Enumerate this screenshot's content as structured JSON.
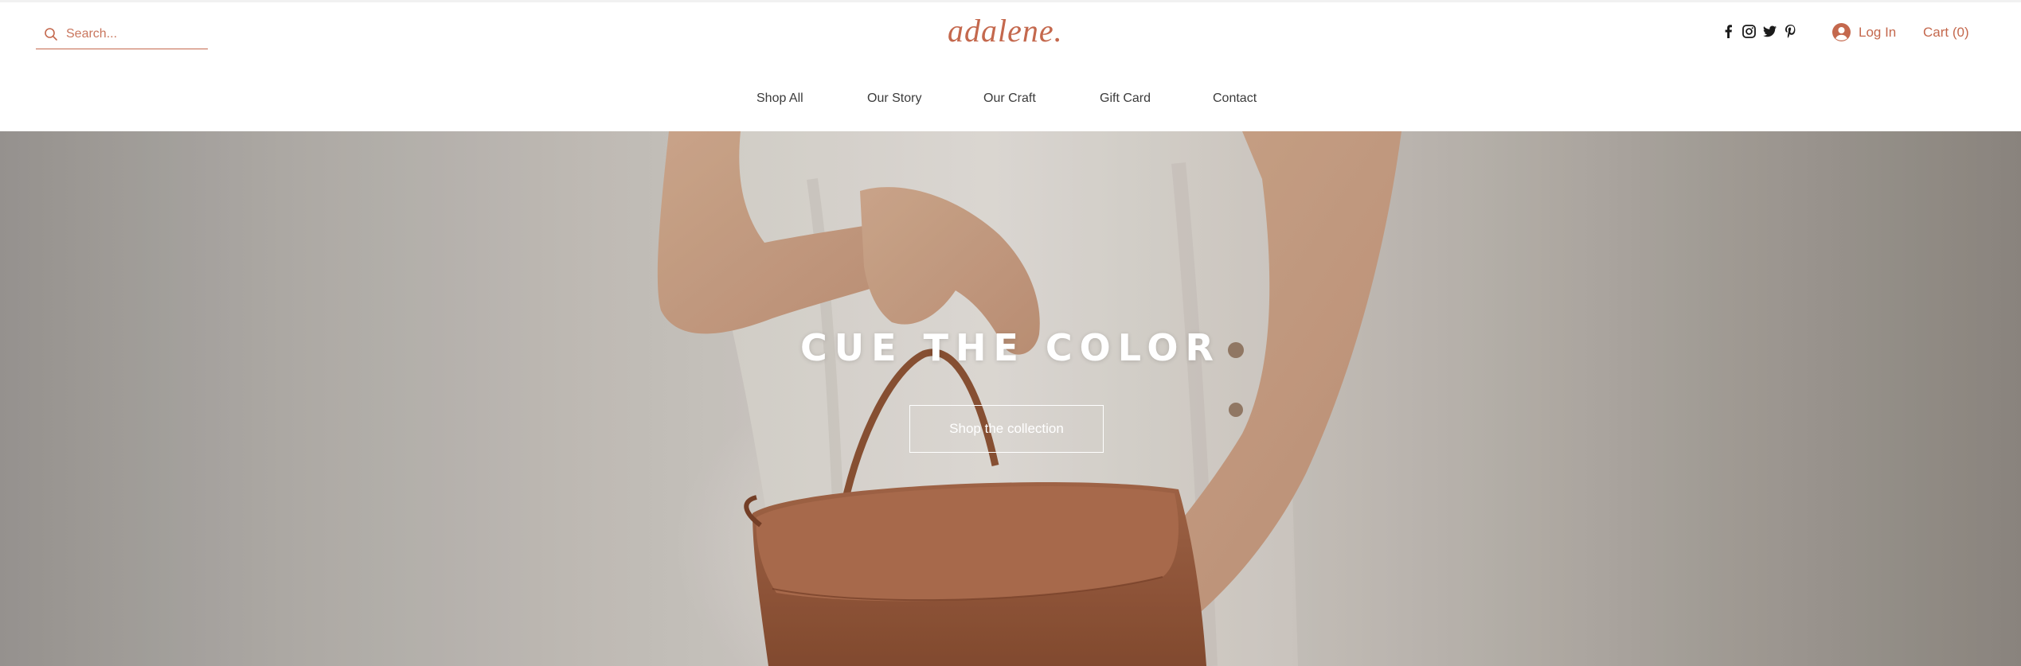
{
  "header": {
    "search": {
      "placeholder": "Search...",
      "icon": "search-icon"
    },
    "logo": "adalene.",
    "social": [
      {
        "name": "facebook-icon",
        "glyph": "f"
      },
      {
        "name": "instagram-icon",
        "glyph": "◎"
      },
      {
        "name": "twitter-icon",
        "glyph": "🐦"
      },
      {
        "name": "pinterest-icon",
        "glyph": "P"
      }
    ],
    "login_label": "Log In",
    "cart_label": "Cart (0)"
  },
  "nav": {
    "items": [
      "Shop All",
      "Our Story",
      "Our Craft",
      "Gift Card",
      "Contact"
    ]
  },
  "hero": {
    "title": "CUE THE COLOR",
    "cta_label": "Shop the collection"
  },
  "colors": {
    "accent": "#c4684d",
    "nav_text": "#3b3b3b",
    "hero_text": "#ffffff"
  }
}
